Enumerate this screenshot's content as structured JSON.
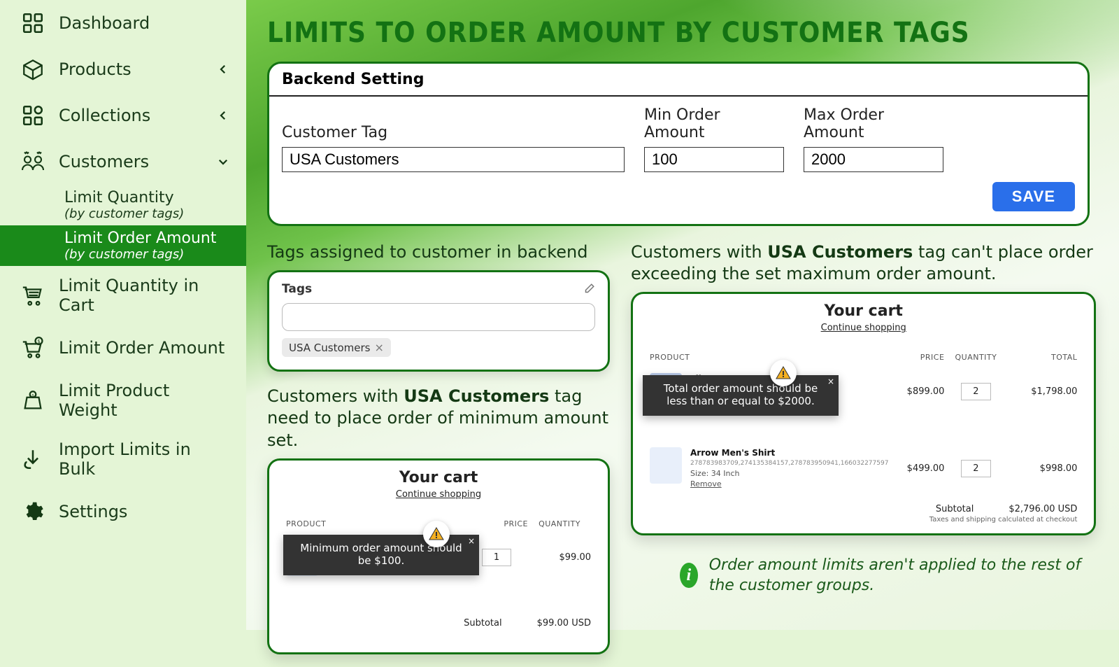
{
  "sidebar": {
    "dashboard": "Dashboard",
    "products": "Products",
    "collections": "Collections",
    "customers": "Customers",
    "sub_lq": "Limit Quantity",
    "sub_lq_sub": "(by customer tags)",
    "sub_loa": "Limit Order Amount",
    "sub_loa_sub": "(by customer tags)",
    "lq_cart": "Limit Quantity in Cart",
    "loa": "Limit Order Amount",
    "lpw": "Limit Product Weight",
    "bulk": "Import Limits in Bulk",
    "settings": "Settings"
  },
  "title": "LIMITS TO ORDER AMOUNT BY CUSTOMER TAGS",
  "panel": {
    "head": "Backend Setting",
    "tag_label": "Customer Tag",
    "tag_value": "USA Customers",
    "min_label": "Min Order Amount",
    "min_value": "100",
    "max_label": "Max Order Amount",
    "max_value": "2000",
    "save": "SAVE"
  },
  "tags_caption": "Tags assigned to customer in backend",
  "tags_card": {
    "head": "Tags",
    "chip": "USA Customers",
    "input_ph": ""
  },
  "min_caption_pre": "Customers with ",
  "min_caption_bold": "USA Customers",
  "min_caption_post": " tag need to place order of minimum amount set.",
  "max_caption_pre": "Customers with ",
  "max_caption_bold": "USA Customers",
  "max_caption_post": " tag can't place order exceeding the set maximum order amount.",
  "cart": {
    "title": "Your cart",
    "cont": "Continue shopping",
    "col_product": "PRODUCT",
    "col_price": "PRICE",
    "col_qty": "QUANTITY",
    "col_total": "TOTAL"
  },
  "cart1": {
    "price1": "$99.00",
    "qty1": "1",
    "tot1": "$99.00",
    "sub_lbl": "Subtotal",
    "sub_val": "$99.00 USD",
    "toast": "Minimum order amount should be $100."
  },
  "cart2": {
    "p1_name": "Libero Jeans",
    "p1_price": "$899.00",
    "p1_qty": "2",
    "p1_tot": "$1,798.00",
    "p2_name": "Arrow Men's Shirt",
    "p2_sku": "278783983709,274135384157,278783950941,166032277597",
    "p2_size": "Size: 34 Inch",
    "p2_rem": "Remove",
    "p2_price": "$499.00",
    "p2_qty": "2",
    "p2_tot": "$998.00",
    "sub_lbl": "Subtotal",
    "sub_val": "$2,796.00 USD",
    "tax": "Taxes and shipping calculated at checkout",
    "toast": "Total order amount should be less than or equal to $2000."
  },
  "note": "Order amount limits aren't applied to the rest of the customer groups."
}
